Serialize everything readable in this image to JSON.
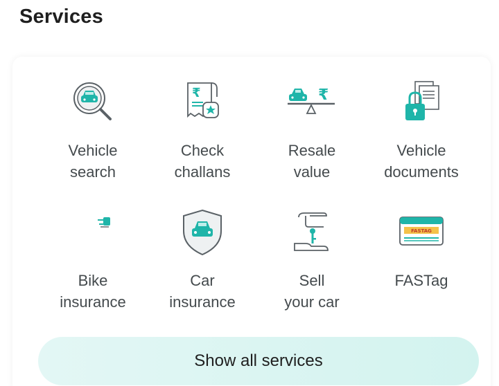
{
  "header": {
    "title": "Services"
  },
  "services": [
    {
      "label": "Vehicle\nsearch",
      "icon": "vehicle-search-icon"
    },
    {
      "label": "Check\nchallans",
      "icon": "challan-receipt-icon"
    },
    {
      "label": "Resale\nvalue",
      "icon": "resale-scale-icon"
    },
    {
      "label": "Vehicle\ndocuments",
      "icon": "documents-lock-icon"
    },
    {
      "label": "Bike\ninsurance",
      "icon": "bike-insurance-icon"
    },
    {
      "label": "Car\ninsurance",
      "icon": "car-shield-icon"
    },
    {
      "label": "Sell\nyour car",
      "icon": "sell-car-key-icon"
    },
    {
      "label": "FASTag",
      "icon": "fastag-card-icon"
    }
  ],
  "fastag_text": "FASTAG",
  "show_all_label": "Show all services",
  "colors": {
    "accent": "#1fb5a9",
    "icon_stroke": "#5a6166",
    "button_bg": "#d9f4f1"
  }
}
